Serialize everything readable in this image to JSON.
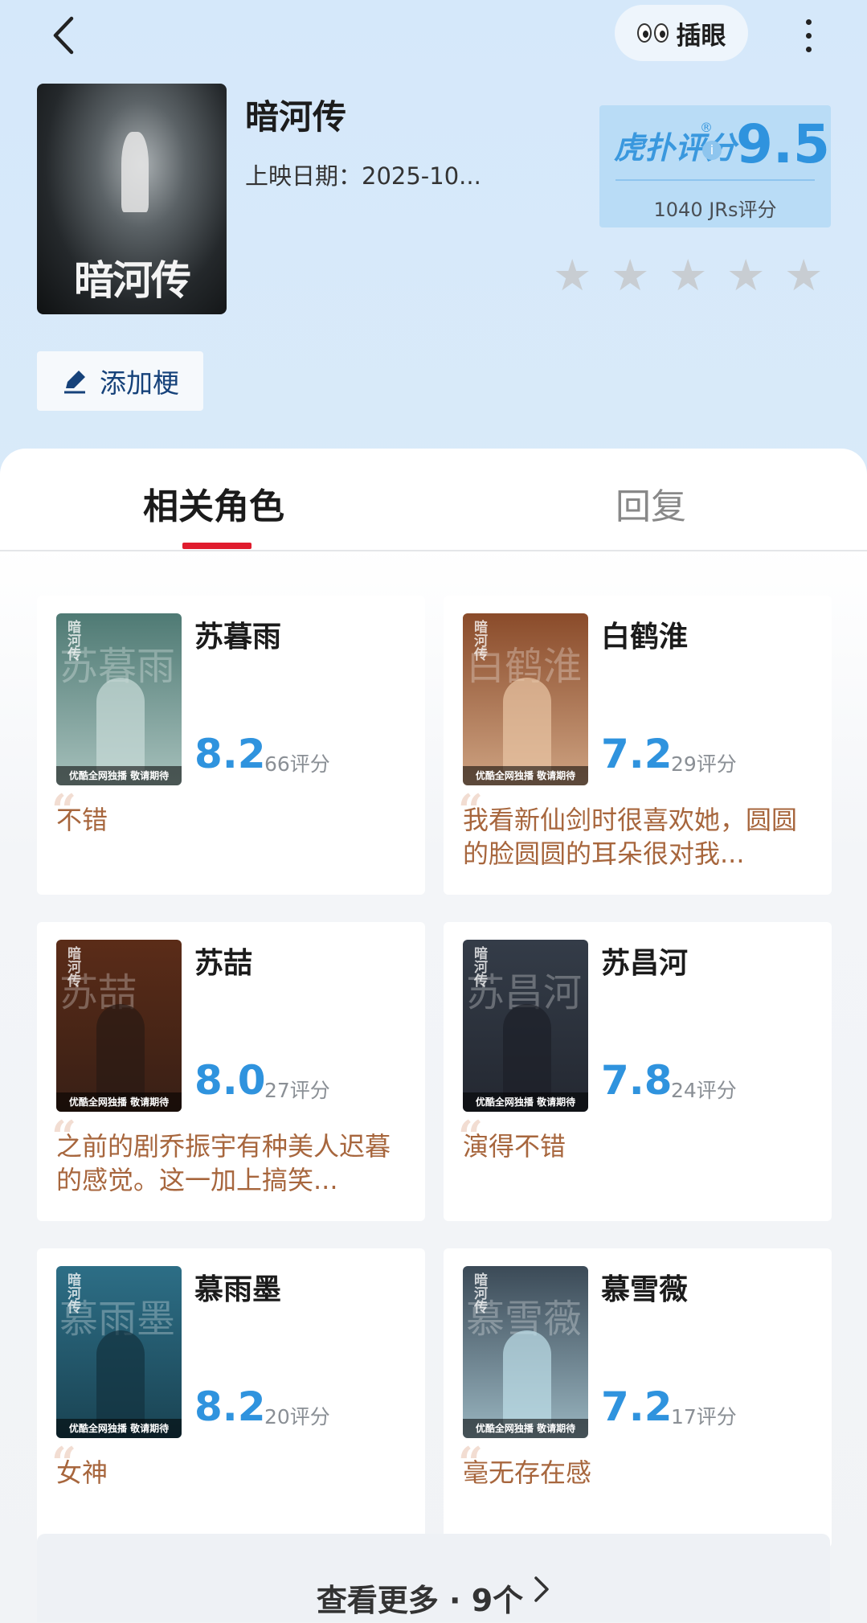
{
  "header": {
    "eye_label": "插眼"
  },
  "show": {
    "title": "暗河传",
    "release": "上映日期：2025-10...",
    "poster_title": "暗河传"
  },
  "score": {
    "logo": "虎扑评分",
    "reg": "®",
    "value": "9.5",
    "count": "1040 JRs评分",
    "stars_filled": 0,
    "stars_total": 5
  },
  "add_meme_label": "添加梗",
  "tabs": [
    {
      "label": "相关角色",
      "active": true
    },
    {
      "label": "回复",
      "active": false
    }
  ],
  "roles": [
    {
      "name": "苏暮雨",
      "rating": "8.2",
      "votes": "66评分",
      "comment": "不错",
      "bg": "#4f7a74",
      "accent": "#c9dcd8",
      "char": "苏暮雨"
    },
    {
      "name": "白鹤淮",
      "rating": "7.2",
      "votes": "29评分",
      "comment": "我看新仙剑时很喜欢她，圆圆的脸圆圆的耳朵很对我...",
      "bg": "#8a4b2a",
      "accent": "#e9c6a5",
      "char": "白鹤淮"
    },
    {
      "name": "苏喆",
      "rating": "8.0",
      "votes": "27评分",
      "comment": "之前的剧乔振宇有种美人迟暮的感觉。这一加上搞笑...",
      "bg": "#5b2c18",
      "accent": "#2a1a14",
      "char": "苏喆"
    },
    {
      "name": "苏昌河",
      "rating": "7.8",
      "votes": "24评分",
      "comment": "演得不错",
      "bg": "#343c48",
      "accent": "#1d2028",
      "char": "苏昌河"
    },
    {
      "name": "慕雨墨",
      "rating": "8.2",
      "votes": "20评分",
      "comment": "女神",
      "bg": "#2d6e86",
      "accent": "#12323e",
      "char": "慕雨墨"
    },
    {
      "name": "慕雪薇",
      "rating": "7.2",
      "votes": "17评分",
      "comment": "毫无存在感",
      "bg": "#3b4a57",
      "accent": "#bfe0ea",
      "char": "慕雪薇"
    }
  ],
  "thumb_footer": "优酷全网独播 敬请期待",
  "more": {
    "label": "查看更多 · 9个"
  },
  "colors": {
    "accent_blue": "#2f93de",
    "tab_underline": "#e01c2d",
    "comment_brown": "#a7663d"
  }
}
